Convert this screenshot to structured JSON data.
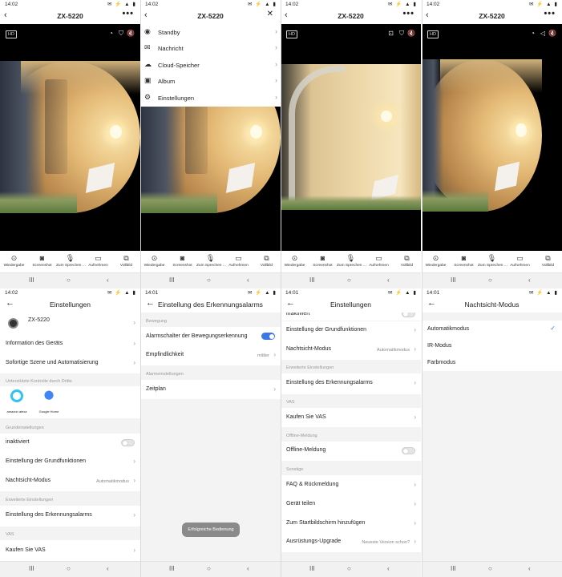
{
  "status": {
    "time_a": "14:02",
    "time_b": "14:01",
    "icons": "✉ ⚡ ▲ ▮"
  },
  "camera": {
    "title": "ZX-5220",
    "hd": "HD",
    "more": "•••",
    "close": "✕",
    "back": "‹",
    "toolbar": [
      {
        "icon": "record-icon",
        "glyph": "⊙",
        "label": "Wiedergabe"
      },
      {
        "icon": "camera-icon",
        "glyph": "◙",
        "label": "Screenshot"
      },
      {
        "icon": "mic-icon",
        "glyph": "🎙",
        "label": "Zum Sprechen ..."
      },
      {
        "icon": "video-icon",
        "glyph": "▭",
        "label": "Aufnehmen"
      },
      {
        "icon": "fullscreen-icon",
        "glyph": "⧉",
        "label": "Vollbild"
      }
    ]
  },
  "menu": {
    "items": [
      {
        "icon": "eye-icon",
        "glyph": "◉",
        "label": "Standby"
      },
      {
        "icon": "mail-icon",
        "glyph": "✉",
        "label": "Nachricht"
      },
      {
        "icon": "cloud-icon",
        "glyph": "☁",
        "label": "Cloud-Speicher"
      },
      {
        "icon": "image-icon",
        "glyph": "▣",
        "label": "Album"
      },
      {
        "icon": "gear-icon",
        "glyph": "⚙",
        "label": "Einstellungen"
      }
    ]
  },
  "nav": {
    "recents": "III",
    "home": "○",
    "back": "‹"
  },
  "settings": {
    "title": "Einstellungen",
    "device": "ZX-5220",
    "info": "Information des Geräts",
    "scene": "Sofortige Szene und Automatisierung",
    "third_party": "Unterstützte Kontrolle durch Dritte",
    "alexa": "amazon alexa",
    "google": "Google Home",
    "basic": "Grundeinstellungen",
    "inactive": "inaktiviert",
    "basic_functions": "Einstellung der Grundfunktionen",
    "night": "Nachtsicht-Modus",
    "night_val": "Automatikmodus",
    "advanced": "Erweiterte Einstellungen",
    "alarm": "Einstellung des Erkennungsalarms",
    "vas": "VAS",
    "buy_vas": "Kaufen Sie VAS",
    "offline_sec": "Offline-Meldung",
    "offline": "Offline-Meldung",
    "other": "Sonstige",
    "faq": "FAQ & Rückmeldung",
    "share": "Gerät teilen",
    "homescreen": "Zum Startbildschirm hinzufügen",
    "upgrade": "Ausrüstungs-Upgrade",
    "upgrade_val": "Neueste Version schon?",
    "partial_top": "inaktiviert"
  },
  "alarm": {
    "title": "Einstellung des Erkennungsalarms",
    "motion": "Bewegung",
    "motion_switch": "Alarmschalter der Bewegungserkennung",
    "sensitivity": "Empfindlichkeit",
    "sensitivity_val": "mittler",
    "alarm_settings": "Alarmeinstellungen",
    "schedule": "Zeitplan",
    "toast": "Erfolgreiche Bedienung"
  },
  "night": {
    "title": "Nachtsicht-Modus",
    "options": [
      "Automatikmodus",
      "IR-Modus",
      "Farbmodus"
    ],
    "selected": 0,
    "check": "✓"
  }
}
